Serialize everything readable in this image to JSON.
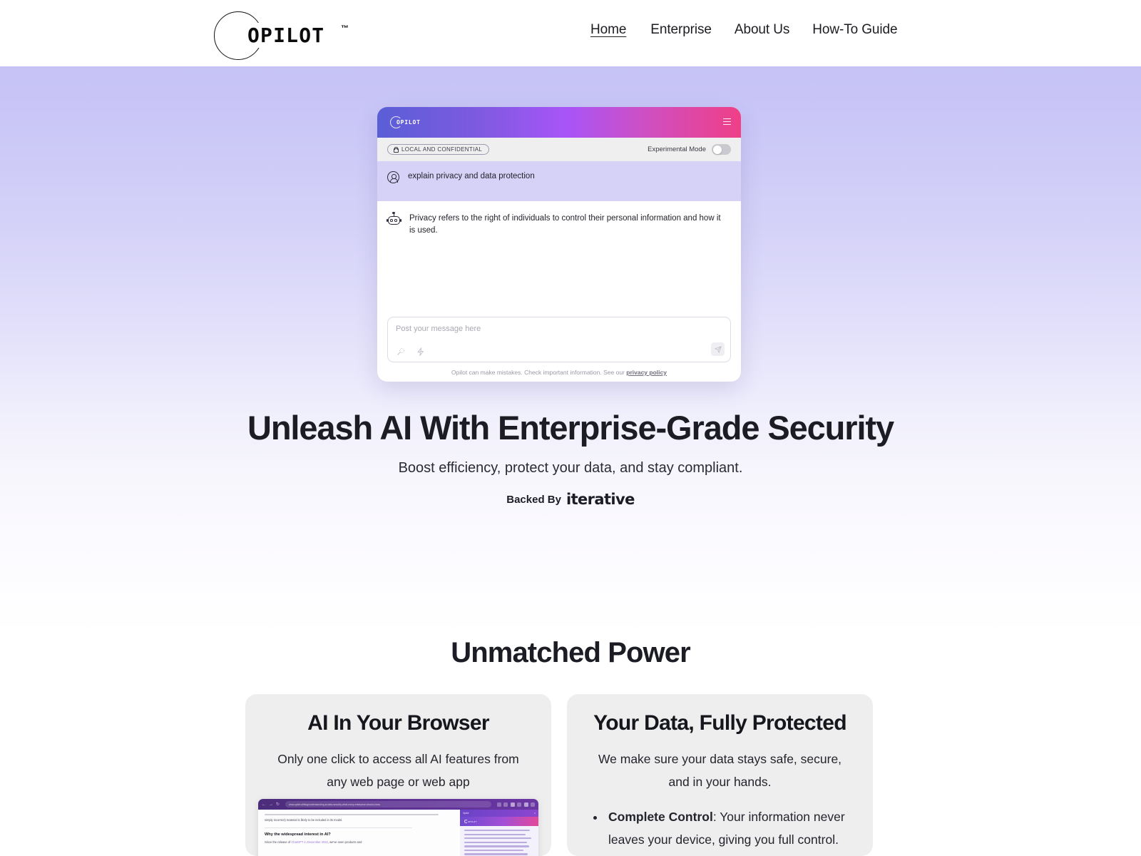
{
  "brand": {
    "name": "OPILOT",
    "trademark": "™"
  },
  "nav": {
    "items": [
      {
        "label": "Home",
        "active": true
      },
      {
        "label": "Enterprise",
        "active": false
      },
      {
        "label": "About Us",
        "active": false
      },
      {
        "label": "How-To Guide",
        "active": false
      }
    ]
  },
  "widget": {
    "logo": "OPILOT",
    "badge": "LOCAL AND CONFIDENTIAL",
    "experimental_label": "Experimental Mode",
    "experimental_on": false,
    "user_message": "explain privacy and data protection",
    "bot_message": "Privacy refers to the right of individuals to control their personal information and how it is used.",
    "composer_placeholder": "Post your message here",
    "disclaimer": "Opilot can make mistakes. Check important information. See our ",
    "disclaimer_link": "privacy policy",
    "colors": {
      "gradient_start": "#5a5ed6",
      "gradient_mid": "#a855f7",
      "gradient_end": "#ef3f86",
      "user_bubble": "#d6d2f7",
      "subbar": "#f0eff0"
    }
  },
  "hero": {
    "title": "Unleash AI With Enterprise-Grade Security",
    "subtitle": "Boost efficiency, protect your data, and stay compliant.",
    "backed_by_label": "Backed By",
    "backed_by_brand": "iterative",
    "bg_top": "#c6c2f6",
    "bg_bottom": "#fbfaff"
  },
  "features": {
    "section_title": "Unmatched Power",
    "cards": [
      {
        "title": "AI In Your Browser",
        "subtitle": "Only one click to access all AI features from any web page or web app",
        "has_browser_mock": true,
        "browser": {
          "url": "www.opilot.ai/blog/understanding-ai-data-security-what-every-enterprise-should-know",
          "page_text_top": "simply incorrect) material is likely to be included in its model.",
          "page_heading": "Why the widespread interest in AI?",
          "page_text_body_prefix": "Since the release of ",
          "page_text_body_link": "ChatGPT in December 2022",
          "page_text_body_suffix": ", we've seen products and",
          "sidebar_logo": "OPILOT"
        }
      },
      {
        "title": "Your Data, Fully Protected",
        "subtitle": "We make sure your data stays safe, secure, and in your hands.",
        "bullets": [
          {
            "bold": "Complete Control",
            "text": ": Your information never leaves your device, giving you full control."
          }
        ]
      }
    ]
  }
}
